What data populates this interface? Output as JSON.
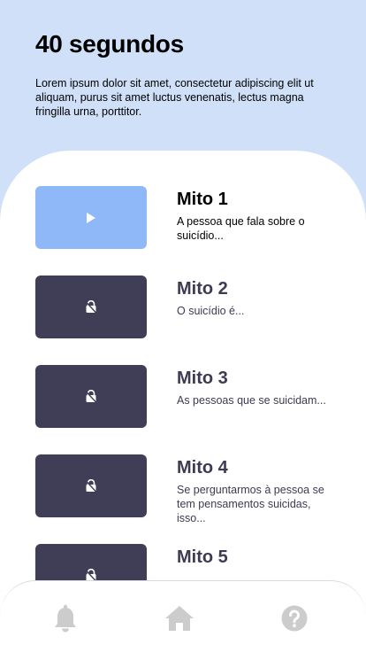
{
  "header": {
    "title": "40 segundos",
    "intro": "Lorem ipsum dolor sit amet, consectetur adipiscing elit ut aliquam, purus sit amet luctus venenatis, lectus magna fringilla urna, porttitor."
  },
  "myths": [
    {
      "title": "Mito 1",
      "description": "A pessoa que fala sobre o suicídio...",
      "state": "unlocked",
      "icon": "play-icon"
    },
    {
      "title": "Mito 2",
      "description": "O suicídio é...",
      "state": "locked",
      "icon": "lock-icon"
    },
    {
      "title": "Mito 3",
      "description": "As pessoas que se suicidam...",
      "state": "locked",
      "icon": "lock-icon"
    },
    {
      "title": "Mito 4",
      "description": "Se perguntarmos à pessoa se tem pensamentos suicidas, isso...",
      "state": "locked",
      "icon": "lock-icon"
    },
    {
      "title": "Mito 5",
      "description": "",
      "state": "locked",
      "icon": "lock-icon"
    }
  ],
  "bottom_nav": {
    "items": [
      {
        "icon": "bell-icon"
      },
      {
        "icon": "home-icon"
      },
      {
        "icon": "help-icon"
      }
    ],
    "icon_color": "#cccccc"
  },
  "colors": {
    "background": "#cfe0f8",
    "active_thumb": "#8fb8f8",
    "locked_thumb": "#403d57",
    "title_text": "#3d3a52"
  }
}
